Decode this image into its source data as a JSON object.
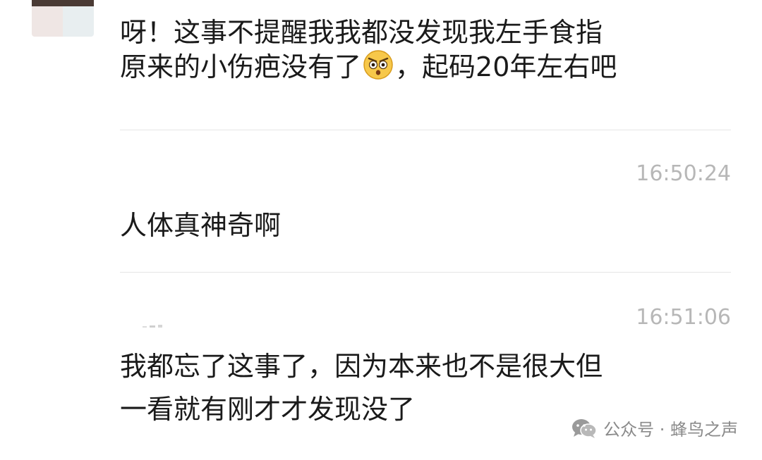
{
  "messages": [
    {
      "lines": [
        "呀！这事不提醒我我都没发现我左手食指"
      ],
      "line2_before": "原来的小伤疤没有了",
      "line2_after": "，起码20年左右吧",
      "emoji": "astonished-angry-face-icon"
    },
    {
      "time": "16:50:24",
      "lines": [
        "人体真神奇啊"
      ]
    },
    {
      "time": "16:51:06",
      "lines": [
        "我都忘了这事了，因为本来也不是很大但",
        "一看就有刚才才发现没了"
      ]
    }
  ],
  "watermark": {
    "icon": "wechat-icon",
    "text": "公众号 · 蜂鸟之声"
  },
  "colors": {
    "text": "#1a1a1a",
    "timestamp": "#b7b7b7",
    "divider": "#e6e6e6",
    "watermark": "#8a8a8a",
    "emoji_face": "#f7c84a"
  }
}
